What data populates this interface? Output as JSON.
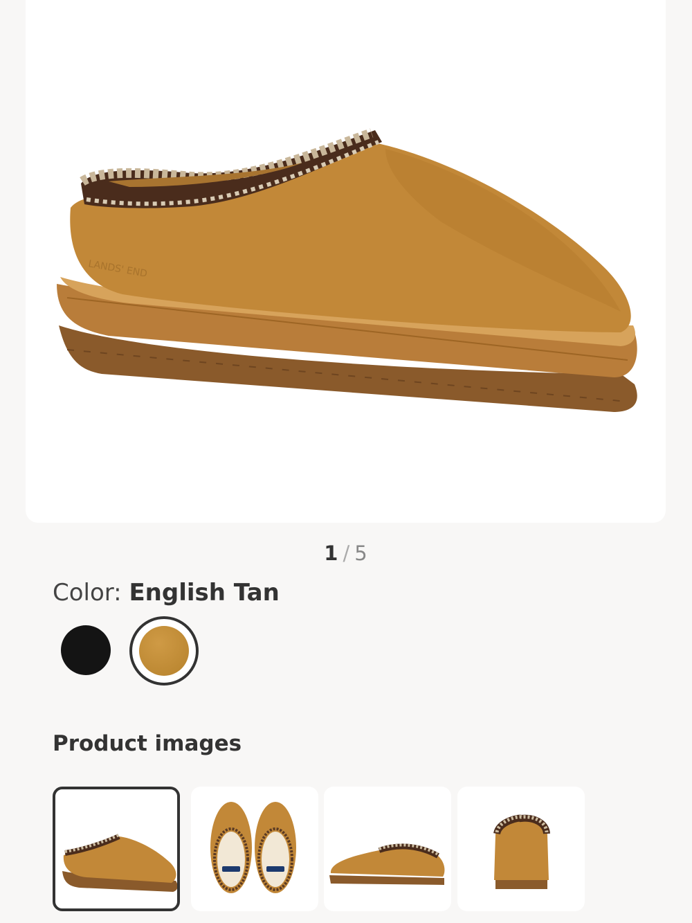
{
  "gallery": {
    "current": "1",
    "separator": "/",
    "total": "5"
  },
  "color": {
    "label": "Color:",
    "selected": "English Tan",
    "swatches": [
      {
        "name": "Black",
        "hex": "#141414"
      },
      {
        "name": "English Tan",
        "hex": "#c0893a"
      }
    ]
  },
  "product_images": {
    "title": "Product images",
    "count_visible": 4
  },
  "product": {
    "brand_embossed": "LANDS' END"
  }
}
